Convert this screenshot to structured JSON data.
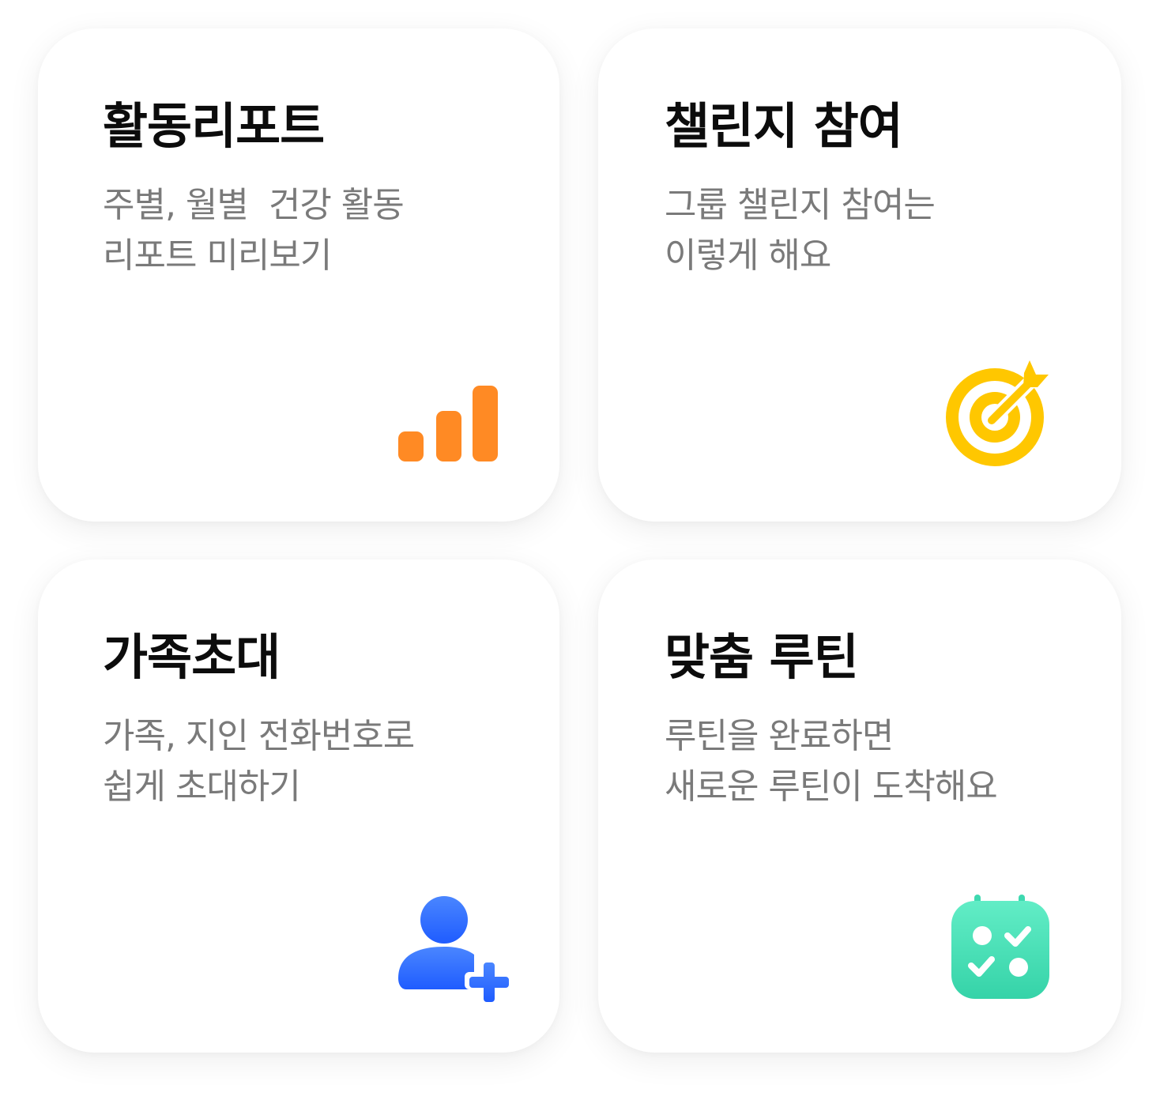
{
  "cards": [
    {
      "title": "활동리포트",
      "desc": [
        "주별, 월별  건강 활동",
        "리포트 미리보기"
      ],
      "icon": "bar-chart-icon",
      "color": "#FF8A24"
    },
    {
      "title": "챌린지 참여",
      "desc": [
        "그룹 챌린지 참여는",
        "이렇게 해요"
      ],
      "icon": "target-icon",
      "color": "#FFC700"
    },
    {
      "title": "가족초대",
      "desc": [
        "가족, 지인 전화번호로",
        "쉽게 초대하기"
      ],
      "icon": "add-user-icon",
      "color": "#2F6BFF"
    },
    {
      "title": "맞춤 루틴",
      "desc": [
        "루틴을 완료하면",
        "새로운 루틴이 도착해요"
      ],
      "icon": "calendar-check-icon",
      "color": "#3ED9B0"
    }
  ]
}
